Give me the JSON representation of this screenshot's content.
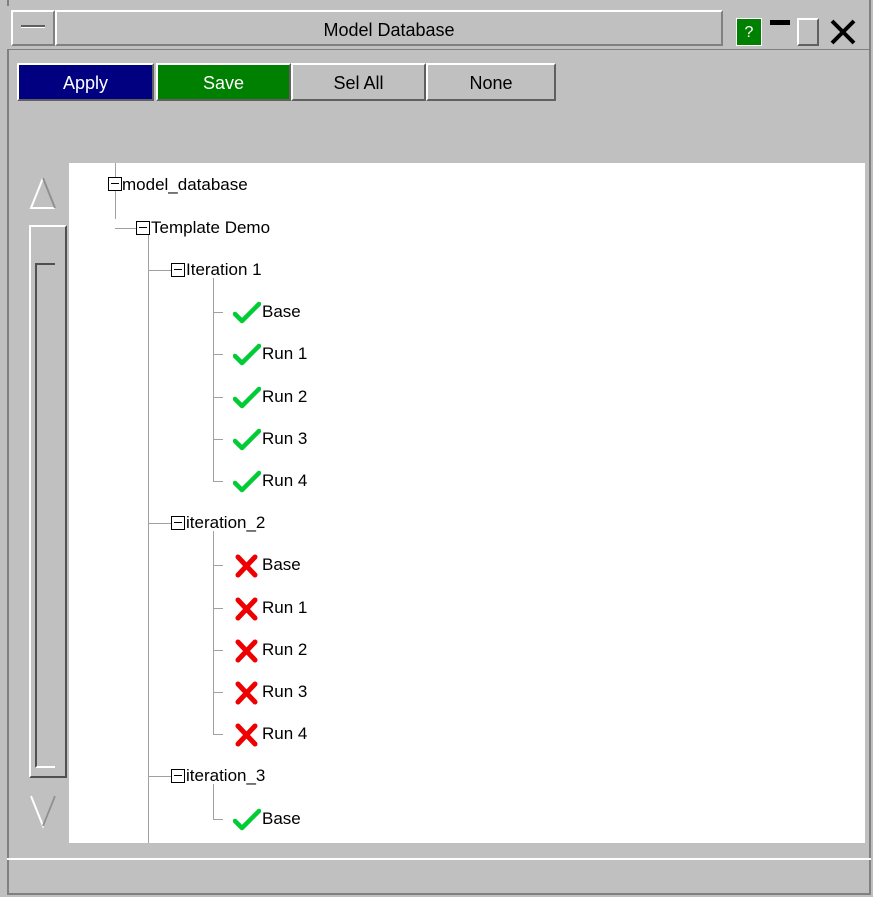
{
  "window": {
    "title": "Model Database",
    "help_label": "?",
    "close_glyph": "✕"
  },
  "toolbar": {
    "apply_label": "Apply",
    "save_label": "Save",
    "sel_all_label": "Sel All",
    "none_label": "None"
  },
  "colors": {
    "apply_bg": "#000080",
    "save_bg": "#008000",
    "help_bg": "#008000",
    "ok_icon": "#00cc33",
    "fail_icon": "#ee0000"
  },
  "tree": {
    "root": {
      "label": "model_database",
      "expanded": true
    },
    "template": {
      "label": "Template Demo",
      "expanded": true
    },
    "iterations": [
      {
        "label": "Iteration 1",
        "expanded": true,
        "items": [
          {
            "label": "Base",
            "status": "check-icon"
          },
          {
            "label": "Run 1",
            "status": "check-icon"
          },
          {
            "label": "Run 2",
            "status": "check-icon"
          },
          {
            "label": "Run 3",
            "status": "check-icon"
          },
          {
            "label": "Run 4",
            "status": "check-icon"
          }
        ]
      },
      {
        "label": "iteration_2",
        "expanded": true,
        "items": [
          {
            "label": "Base",
            "status": "cross-icon"
          },
          {
            "label": "Run 1",
            "status": "cross-icon"
          },
          {
            "label": "Run 2",
            "status": "cross-icon"
          },
          {
            "label": "Run 3",
            "status": "cross-icon"
          },
          {
            "label": "Run 4",
            "status": "cross-icon"
          }
        ]
      },
      {
        "label": "iteration_3",
        "expanded": true,
        "items": [
          {
            "label": "Base",
            "status": "check-icon"
          }
        ]
      }
    ]
  }
}
